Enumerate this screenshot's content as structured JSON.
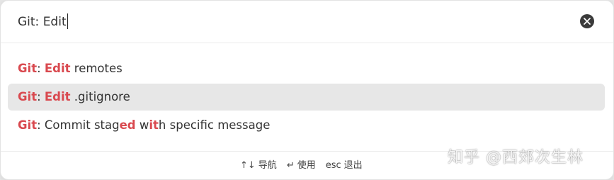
{
  "search": {
    "value": "Git: Edit",
    "placeholder": ""
  },
  "results": [
    {
      "selected": false,
      "segments": [
        {
          "text": "Git",
          "hl": true
        },
        {
          "text": ": ",
          "hl": false
        },
        {
          "text": "Edit",
          "hl": true
        },
        {
          "text": " remotes",
          "hl": false
        }
      ]
    },
    {
      "selected": true,
      "segments": [
        {
          "text": "Git",
          "hl": true
        },
        {
          "text": ": ",
          "hl": false
        },
        {
          "text": "Edit",
          "hl": true
        },
        {
          "text": " .gitignore",
          "hl": false
        }
      ]
    },
    {
      "selected": false,
      "segments": [
        {
          "text": "Git",
          "hl": true
        },
        {
          "text": ": Commit stag",
          "hl": false
        },
        {
          "text": "ed",
          "hl": true
        },
        {
          "text": " w",
          "hl": false
        },
        {
          "text": "it",
          "hl": true
        },
        {
          "text": "h specific message",
          "hl": false
        }
      ]
    }
  ],
  "footer": {
    "hints": [
      {
        "key": "↑↓",
        "label": "导航"
      },
      {
        "key": "↵",
        "label": "使用"
      },
      {
        "key": "esc",
        "label": "退出"
      }
    ]
  },
  "watermark": "知乎 @西郊次生林",
  "icons": {
    "clear": "close-circle-icon"
  },
  "colors": {
    "highlight": "#d9494f",
    "selected_bg": "#e7e7e7",
    "text": "#333333"
  }
}
